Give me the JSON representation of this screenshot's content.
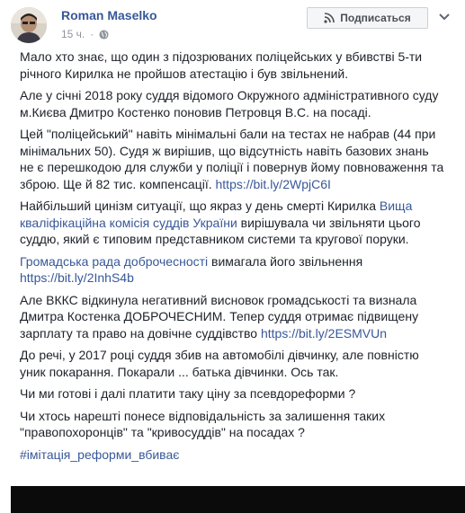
{
  "post": {
    "author": "Roman Maselko",
    "timestamp": "15 ч.",
    "subscribe_label": "Подписаться",
    "colors": {
      "link": "#385898",
      "author": "#365899",
      "meta": "#90949c"
    },
    "icons": [
      "avatar",
      "globe-icon",
      "rss-icon",
      "more-icon"
    ],
    "paragraphs": [
      {
        "lines": [
          "Мало хто знає, що один з підозрюваних поліцейських у вбивстві 5-ти",
          "річного Кирилка не пройшов атестацію і був звільнений."
        ]
      },
      {
        "lines": [
          "Але у січні 2018 року суддя відомого Окружного адміністративного суду",
          "м.Києва Дмитро Костенко поновив Петровця В.С. на посаді."
        ]
      },
      {
        "lines": [
          "Цей \"поліцейський\" навіть мінімальні бали на тестах не набрав (44 при",
          "мінімальних 50). Судя ж вирішив, що відсутність навіть базових знань",
          "не є перешкодою для служби у поліції і повернув йому повноваження та"
        ],
        "last_text": "зброю. Ще й 82 тис. компенсації. ",
        "link": "https://bit.ly/2WpjC6I"
      },
      {
        "line1_text": "Найбільший цинізм ситуації, що якраз у день смерті Кирилка ",
        "line1_link": "Вища",
        "line2_link": "кваліфікаційна комісія суддів України",
        "line2_text": " вирішувала чи звільняти цього",
        "line3": "суддю, який є типовим представником системи та кругової поруки."
      },
      {
        "link": "Громадська рада доброчесності",
        "text": " вимагала його звільнення",
        "link2": "https://bit.ly/2InhS4b"
      },
      {
        "lines": [
          "Але ВККС відкинула негативний висновок громадськості та визнала",
          "Дмитра Костенка ДОБРОЧЕСНИМ. Тепер суддя отримає підвищену"
        ],
        "last_text": "зарплату та право на довічне суддівство ",
        "link": "https://bit.ly/2ESMVUn"
      },
      {
        "lines": [
          "До речі, у 2017 році суддя збив на автомобілі дівчинку, але повністю",
          "уник покарання. Покарали ... батька дівчинки. Ось так."
        ]
      },
      {
        "lines": [
          "Чи ми готові і далі платити таку ціну за псевдореформи ?"
        ]
      },
      {
        "lines": [
          "Чи хтось нарешті понесе відповідальність за залишення таких",
          "\"правопохоронців\" та \"кривосуддів\" на посадах ?"
        ]
      }
    ],
    "hashtag": "#імітація_реформи_вбиває"
  }
}
